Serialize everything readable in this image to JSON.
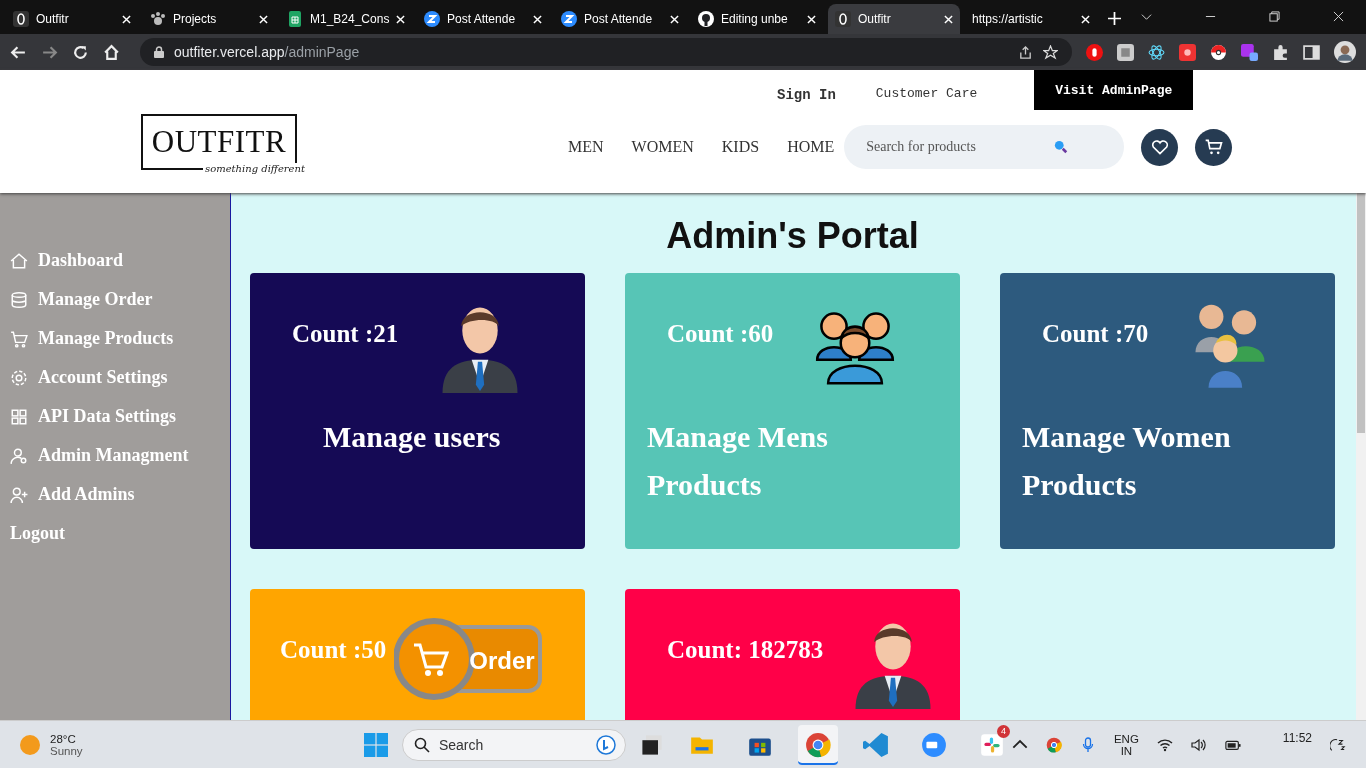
{
  "browser": {
    "tabs": [
      {
        "label": "Outfitr",
        "kind": "outfitr",
        "selected": false
      },
      {
        "label": "Projects",
        "kind": "paw",
        "selected": false
      },
      {
        "label": "M1_B24_Cons",
        "kind": "sheets",
        "selected": false
      },
      {
        "label": "Post Attende",
        "kind": "zoom",
        "selected": false
      },
      {
        "label": "Post Attende",
        "kind": "zoom",
        "selected": false
      },
      {
        "label": "Editing unbe",
        "kind": "github",
        "selected": false
      },
      {
        "label": "Outfitr",
        "kind": "outfitr",
        "selected": true
      },
      {
        "label": "https://artistic",
        "kind": "blank",
        "selected": false
      }
    ],
    "address": {
      "host": "outfiter.vercel.app",
      "path": "/adminPage"
    }
  },
  "header": {
    "top_links": [
      {
        "label": "Sign In",
        "kind": "bold"
      },
      {
        "label": "Customer Care",
        "kind": "plain"
      }
    ],
    "admin_button": "Visit AdminPage",
    "logo": {
      "name": "OUTFITR",
      "tagline": "something different"
    },
    "nav": [
      "MEN",
      "WOMEN",
      "KIDS",
      "HOME"
    ],
    "search": {
      "placeholder": "Search for products"
    }
  },
  "sidebar": {
    "items": [
      {
        "label": "Dashboard",
        "kind": "home"
      },
      {
        "label": "Manage Order",
        "kind": "database"
      },
      {
        "label": "Manage Products",
        "kind": "cart"
      },
      {
        "label": "Account Settings",
        "kind": "gear"
      },
      {
        "label": "API Data Settings",
        "kind": "grid"
      },
      {
        "label": "Admin Managment",
        "kind": "admin"
      },
      {
        "label": "Add Admins",
        "kind": "add-user"
      },
      {
        "label": "Logout",
        "kind": "none"
      }
    ]
  },
  "main": {
    "title": "Admin's Portal",
    "cards": [
      {
        "count": "Count :21",
        "title": "Manage users",
        "color": "#150a55",
        "kind": "person"
      },
      {
        "count": "Count :60",
        "title": "Manage Mens Products",
        "color": "#57c5b6",
        "kind": "group"
      },
      {
        "count": "Count :70",
        "title": "Manage Women Products",
        "color": "#2d5a7e",
        "kind": "team"
      },
      {
        "count": "Count :50",
        "color": "#ffa500",
        "kind": "order",
        "icon_text": "Order"
      },
      {
        "count": "Count: 182783",
        "color": "#ff0048",
        "kind": "person"
      }
    ]
  },
  "taskbar": {
    "weather": {
      "temp": "28°C",
      "condition": "Sunny"
    },
    "search": {
      "placeholder": "Search"
    },
    "apps": [
      {
        "kind": "explorer",
        "selected": false
      },
      {
        "kind": "store",
        "selected": false
      },
      {
        "kind": "chrome",
        "selected": true
      },
      {
        "kind": "vscode",
        "selected": false
      },
      {
        "kind": "zoom",
        "selected": false
      },
      {
        "kind": "slack",
        "selected": false,
        "badge": "4"
      }
    ],
    "language": [
      "ENG",
      "IN"
    ],
    "time": "11:52"
  }
}
